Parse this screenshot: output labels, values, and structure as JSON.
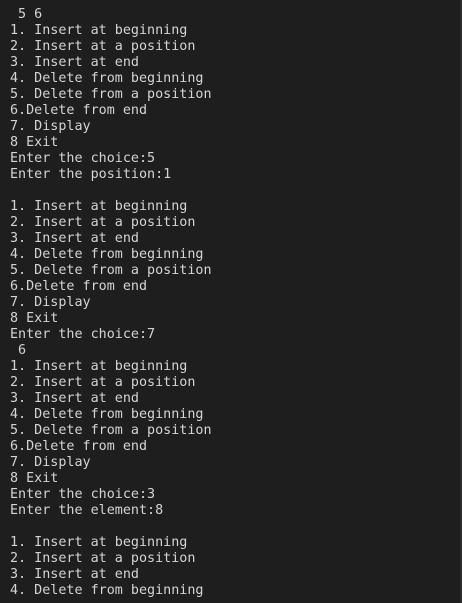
{
  "terminal": {
    "lines": [
      " 5 6",
      "1. Insert at beginning",
      "2. Insert at a position",
      "3. Insert at end",
      "4. Delete from beginning",
      "5. Delete from a position",
      "6.Delete from end",
      "7. Display",
      "8 Exit",
      "Enter the choice:5",
      "Enter the position:1",
      "",
      "1. Insert at beginning",
      "2. Insert at a position",
      "3. Insert at end",
      "4. Delete from beginning",
      "5. Delete from a position",
      "6.Delete from end",
      "7. Display",
      "8 Exit",
      "Enter the choice:7",
      " 6",
      "1. Insert at beginning",
      "2. Insert at a position",
      "3. Insert at end",
      "4. Delete from beginning",
      "5. Delete from a position",
      "6.Delete from end",
      "7. Display",
      "8 Exit",
      "Enter the choice:3",
      "Enter the element:8",
      "",
      "1. Insert at beginning",
      "2. Insert at a position",
      "3. Insert at end",
      "4. Delete from beginning"
    ]
  },
  "colors": {
    "background": "#1e1e1e",
    "text": "#d4d4d4"
  }
}
